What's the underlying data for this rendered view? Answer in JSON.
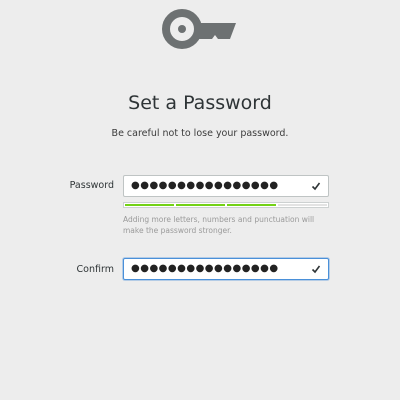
{
  "header": {
    "icon": "key-icon",
    "title": "Set a Password",
    "subtitle": "Be careful not to lose your password."
  },
  "form": {
    "password": {
      "label": "Password",
      "value_masked": "●●●●●●●●●●●●●●●●",
      "status_icon": "check-icon"
    },
    "strength": {
      "segments": 4,
      "filled": 3,
      "color": "#73d216",
      "hint": "Adding more letters, numbers and punctuation will make the password stronger."
    },
    "confirm": {
      "label": "Confirm",
      "value_masked": "●●●●●●●●●●●●●●●●",
      "status_icon": "check-icon"
    }
  },
  "colors": {
    "background": "#ededed",
    "focus_border": "#4a90d9",
    "icon": "#6d7172"
  }
}
